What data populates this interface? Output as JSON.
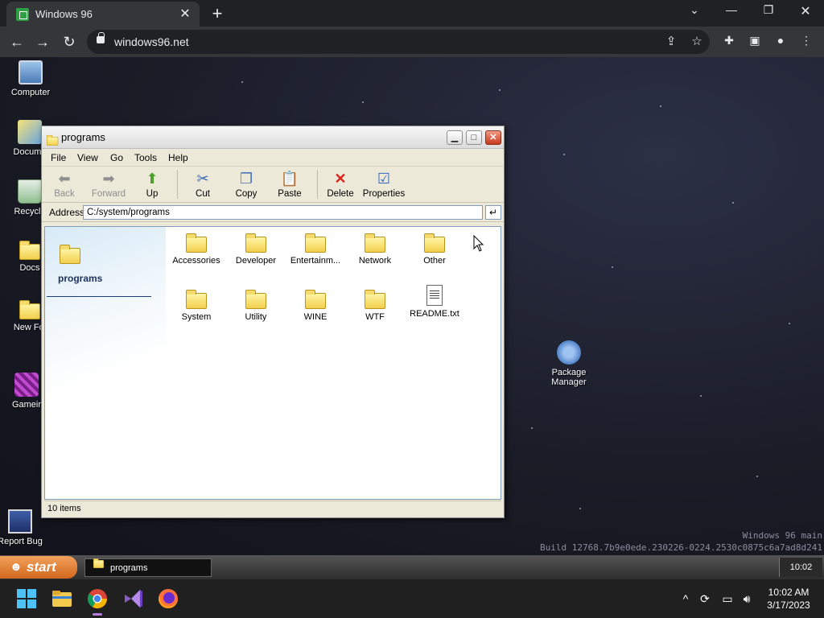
{
  "browser": {
    "tab_title": "Windows 96",
    "url": "windows96.net"
  },
  "desktop": {
    "icons": [
      {
        "label": "Computer"
      },
      {
        "label": "Docume"
      },
      {
        "label": "Recycle"
      },
      {
        "label": "Docs"
      },
      {
        "label": "New Fol"
      },
      {
        "label": "Gameir"
      },
      {
        "label": "Report Bug"
      },
      {
        "label": "Package Manager"
      }
    ],
    "build_line1": "Windows 96 main",
    "build_line2": "Build 12768.7b9e0ede.230226-0224.2530c0875c6a7ad8d241"
  },
  "window": {
    "title": "programs",
    "menu": [
      "File",
      "View",
      "Go",
      "Tools",
      "Help"
    ],
    "toolbar": {
      "back": "Back",
      "forward": "Forward",
      "up": "Up",
      "cut": "Cut",
      "copy": "Copy",
      "paste": "Paste",
      "delete": "Delete",
      "properties": "Properties"
    },
    "address_label": "Address",
    "address_value": "C:/system/programs",
    "pane_title": "programs",
    "items": [
      {
        "label": "Accessories",
        "type": "folder"
      },
      {
        "label": "Developer",
        "type": "folder"
      },
      {
        "label": "Entertainm...",
        "type": "folder"
      },
      {
        "label": "Network",
        "type": "folder"
      },
      {
        "label": "Other",
        "type": "folder"
      },
      {
        "label": "System",
        "type": "folder"
      },
      {
        "label": "Utility",
        "type": "folder"
      },
      {
        "label": "WINE",
        "type": "folder"
      },
      {
        "label": "WTF",
        "type": "folder"
      },
      {
        "label": "README.txt",
        "type": "text-file"
      }
    ],
    "status": "10 items"
  },
  "w96taskbar": {
    "start_label": "start",
    "task_label": "programs",
    "clock": "10:02"
  },
  "win11taskbar": {
    "time": "10:02 AM",
    "date": "3/17/2023"
  },
  "colors": {
    "start_button": "#d2661e",
    "close_button": "#c9381c",
    "address_border": "#7f9db9"
  }
}
